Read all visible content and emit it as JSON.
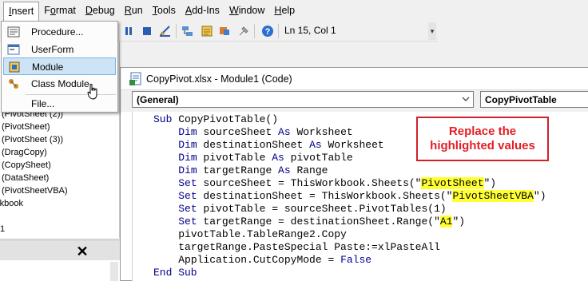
{
  "menubar": {
    "items": [
      {
        "label": "Insert",
        "ul": "I"
      },
      {
        "label": "Format",
        "ul": "o"
      },
      {
        "label": "Debug",
        "ul": "D"
      },
      {
        "label": "Run",
        "ul": "R"
      },
      {
        "label": "Tools",
        "ul": "T"
      },
      {
        "label": "Add-Ins",
        "ul": "A"
      },
      {
        "label": "Window",
        "ul": "W"
      },
      {
        "label": "Help",
        "ul": "H"
      }
    ]
  },
  "insert_menu": {
    "items": [
      {
        "label": "Procedure...",
        "icon": "procedure-icon"
      },
      {
        "label": "UserForm",
        "icon": "userform-icon"
      },
      {
        "label": "Module",
        "icon": "module-icon",
        "highlighted": true
      },
      {
        "label": "Class Module",
        "icon": "class-module-icon"
      },
      {
        "label": "File...",
        "icon": ""
      }
    ]
  },
  "toolbar": {
    "status": "Ln 15, Col 1"
  },
  "project_tree": {
    "items": [
      "(PivotSheet (2))",
      "(PivotSheet)",
      "(PivotSheet (3))",
      "(DragCopy)",
      "(CopySheet)",
      "(DataSheet)",
      "(PivotSheetVBA)",
      "rkbook",
      "1"
    ]
  },
  "properties_panel": {
    "close_label": "✕"
  },
  "code_window": {
    "title": "CopyPivot.xlsx - Module1 (Code)",
    "object_combo": "(General)",
    "procedure_combo": "CopyPivotTable"
  },
  "callout": {
    "line1": "Replace the",
    "line2": "highlighted values"
  },
  "code": {
    "line1_kw": "Sub",
    "line1_rest": " CopyPivotTable()",
    "dim": "Dim",
    "as": "As",
    "set": "Set",
    "line2_var": " sourceSheet ",
    "line2_type": " Worksheet",
    "line3_var": " destinationSheet ",
    "line3_type": " Worksheet",
    "line4_var": " pivotTable ",
    "line4_type": " pivotTable",
    "line5_var": " targetRange ",
    "line5_type": " Range",
    "line6_pre": " sourceSheet = ThisWorkbook.Sheets(\"",
    "line6_hl": "PivotSheet",
    "line6_post": "\")",
    "line7_pre": " destinationSheet = ThisWorkbook.Sheets(\"",
    "line7_hl": "PivotSheetVBA",
    "line7_post": "\")",
    "line8_rest": " pivotTable = sourceSheet.PivotTables(1)",
    "line9_pre": " targetRange = destinationSheet.Range(\"",
    "line9_hl": "A1",
    "line9_post": "\")",
    "line10": "pivotTable.TableRange2.Copy",
    "line11": "targetRange.PasteSpecial Paste:=xlPasteAll",
    "line12_pre": "Application.CutCopyMode = ",
    "line12_kw": "False",
    "line13_kw": "End Sub"
  },
  "colors": {
    "keyword": "#00008b",
    "highlight": "#ffff33",
    "callout": "#e31e24",
    "menu_highlight": "#cde4f7"
  }
}
